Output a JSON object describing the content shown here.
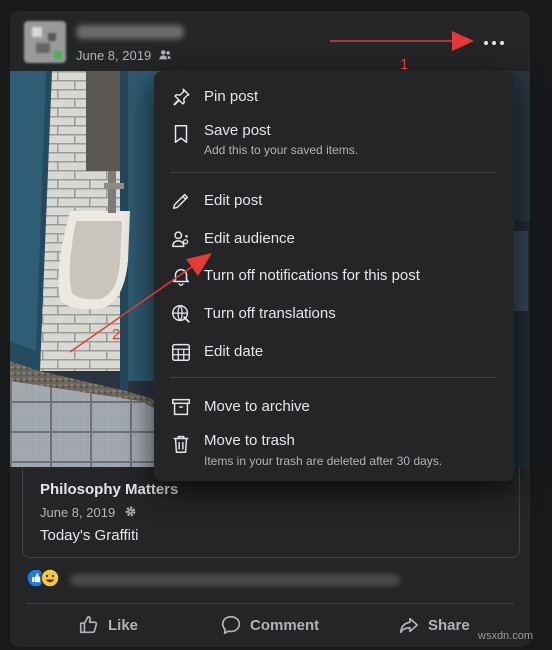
{
  "post": {
    "date": "June 8, 2019",
    "audience_icon": "friends-icon",
    "more_icon": "more-options-icon"
  },
  "shared": {
    "title": "Philosophy Matters",
    "date": "June 8, 2019",
    "text": "Today's Graffiti"
  },
  "menu": {
    "items": [
      {
        "label": "Pin post",
        "icon": "pin-icon"
      },
      {
        "label": "Save post",
        "sub": "Add this to your saved items.",
        "icon": "bookmark-icon"
      },
      {
        "label": "Edit post",
        "icon": "pencil-icon"
      },
      {
        "label": "Edit audience",
        "icon": "audience-icon"
      },
      {
        "label": "Turn off notifications for this post",
        "icon": "bell-icon"
      },
      {
        "label": "Turn off translations",
        "icon": "translate-icon"
      },
      {
        "label": "Edit date",
        "icon": "calendar-icon"
      },
      {
        "label": "Move to archive",
        "icon": "archive-icon"
      },
      {
        "label": "Move to trash",
        "sub": "Items in your trash are deleted after 30 days.",
        "icon": "trash-icon"
      }
    ]
  },
  "actions": {
    "like": "Like",
    "comment": "Comment",
    "share": "Share"
  },
  "annotations": {
    "one": "1",
    "two": "2",
    "color": "#e53935"
  },
  "watermark": "wsxdn.com"
}
